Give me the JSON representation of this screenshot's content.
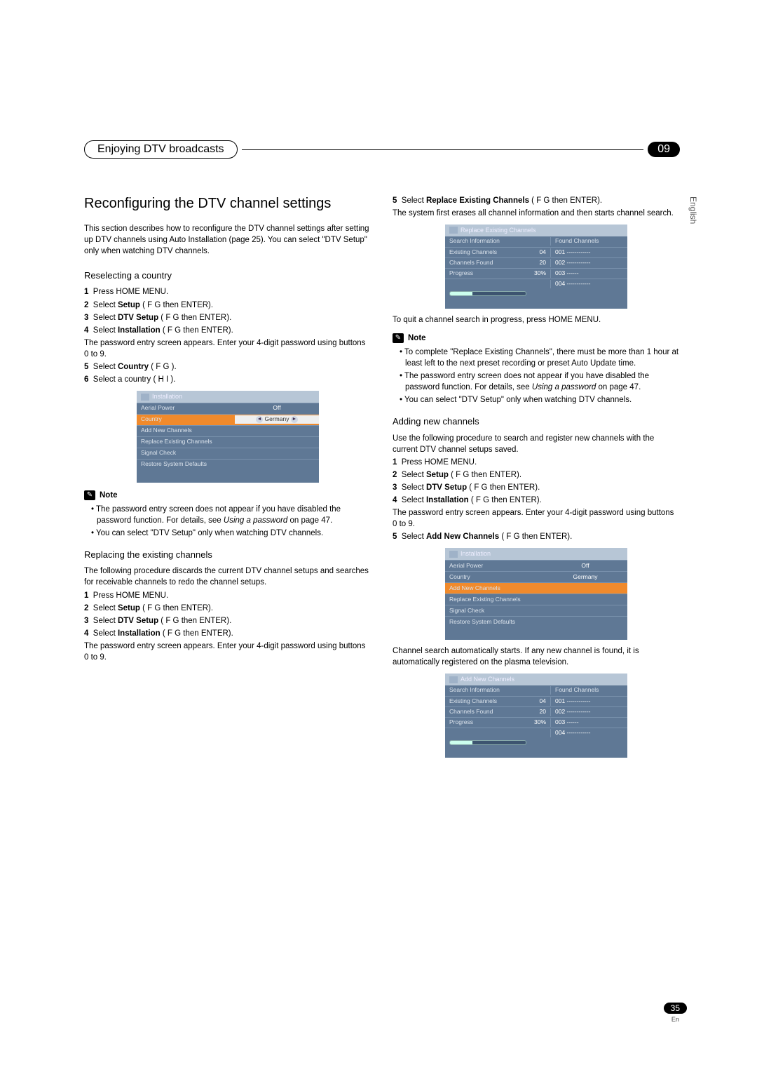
{
  "chapter": {
    "title": "Enjoying DTV broadcasts",
    "number": "09"
  },
  "sideLang": "English",
  "pageNum": "35",
  "pageEn": "En",
  "h2": "Reconfiguring the DTV channel settings",
  "intro": "This section describes how to reconfigure the DTV channel settings after setting up DTV channels using Auto Installation (page 25). You can select \"DTV Setup\" only when watching DTV channels.",
  "sec1": {
    "h": "Reselecting a country",
    "s1": "Press HOME MENU.",
    "s2a": "Select ",
    "s2b": "Setup",
    "s2c": " (   F   G then ENTER).",
    "s3a": "Select ",
    "s3b": "DTV Setup",
    "s3c": " (   F   G then ENTER).",
    "s4a": "Select ",
    "s4b": "Installation",
    "s4c": " (   F   G then ENTER).",
    "pwd": "The password entry screen appears. Enter your 4-digit password using buttons 0 to 9.",
    "s5a": "Select ",
    "s5b": "Country",
    "s5c": " (   F   G ).",
    "s6": "Select a country (   H   I )."
  },
  "menu1": {
    "title": "Installation",
    "r1l": "Aerial Power",
    "r1r": "Off",
    "r2l": "Country",
    "r2r": "Germany",
    "r3l": "Add New Channels",
    "r4l": "Replace Existing Channels",
    "r5l": "Signal Check",
    "r6l": "Restore System Defaults"
  },
  "note": {
    "label": "Note"
  },
  "note1": {
    "b1a": "The password entry screen does not appear if you have disabled the password function. For details, see ",
    "b1i": "Using a password",
    "b1b": " on page 47.",
    "b2": "You can select \"DTV Setup\" only when watching DTV channels."
  },
  "sec2": {
    "h": "Replacing the existing channels",
    "intro": "The following procedure discards the current DTV channel setups and searches for receivable channels to redo the channel setups.",
    "s1": "Press HOME MENU.",
    "s2a": "Select ",
    "s2b": "Setup",
    "s2c": " (   F   G then ENTER).",
    "s3a": "Select ",
    "s3b": "DTV Setup",
    "s3c": " (   F   G then ENTER).",
    "s4a": "Select ",
    "s4b": "Installation",
    "s4c": " (   F   G then ENTER).",
    "pwd": "The password entry screen appears. Enter your 4-digit password using buttons 0 to 9."
  },
  "colR": {
    "s5a": "Select ",
    "s5b": "Replace Existing Channels",
    "s5c": " (   F   G then ENTER).",
    "body": "The system first erases all channel information and then starts channel search."
  },
  "search": {
    "title": "Replace Existing Channels",
    "hL": "Search Information",
    "hR": "Found Channels",
    "r1l": "Existing Channels",
    "r1v": "04",
    "r1r": "001  ------------",
    "r2l": "Channels Found",
    "r2v": "20",
    "r2r": "002  ------------",
    "r3l": "Progress",
    "r3v": "30%",
    "r3r": "003  ------",
    "r4r": "004  ------------"
  },
  "quit": "To quit a channel search in progress, press HOME MENU.",
  "note2": {
    "b1": "To complete \"Replace Existing Channels\", there must be more than 1 hour at least left to the next preset recording or preset Auto Update time.",
    "b2a": "The password entry screen does not appear if you have disabled the password function. For details, see ",
    "b2i": "Using a password",
    "b2b": " on page 47.",
    "b3": "You can select \"DTV Setup\" only when watching DTV channels."
  },
  "sec3": {
    "h": "Adding new channels",
    "intro": "Use the following procedure to search and register new channels with the current DTV channel setups saved.",
    "s1": "Press HOME MENU.",
    "s2a": "Select ",
    "s2b": "Setup",
    "s2c": " (   F   G then ENTER).",
    "s3a": "Select ",
    "s3b": "DTV Setup",
    "s3c": " (   F   G then ENTER).",
    "s4a": "Select ",
    "s4b": "Installation",
    "s4c": " (   F   G then ENTER).",
    "pwd": "The password entry screen appears. Enter your 4-digit password using buttons 0 to 9.",
    "s5a": "Select ",
    "s5b": "Add New Channels",
    "s5c": " (   F   G then ENTER)."
  },
  "menu2title": "Installation",
  "afterMenu2": "Channel search automatically starts. If any new channel is found, it is automatically registered on the plasma television.",
  "search2title": "Add New Channels"
}
